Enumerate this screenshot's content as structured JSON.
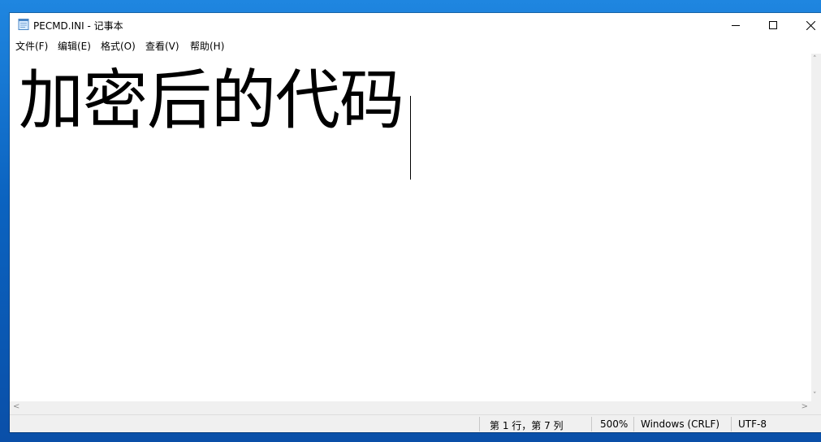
{
  "window": {
    "title": "PECMD.INI - 记事本",
    "icon": "notepad-icon",
    "controls": {
      "minimize_icon": "minimize-icon",
      "maximize_icon": "maximize-icon",
      "close_icon": "close-icon"
    }
  },
  "menu": {
    "items": [
      {
        "label": "文件(F)"
      },
      {
        "label": "编辑(E)"
      },
      {
        "label": "格式(O)"
      },
      {
        "label": "查看(V)"
      },
      {
        "label": "帮助(H)"
      }
    ]
  },
  "editor": {
    "content": "加密后的代码"
  },
  "scrollbars": {
    "up_arrow": "˄",
    "down_arrow": "˅",
    "left_arrow": "<",
    "right_arrow": ">"
  },
  "status": {
    "position": "第 1 行，第 7 列",
    "zoom": "500%",
    "line_ending": "Windows (CRLF)",
    "encoding": "UTF-8"
  },
  "colors": {
    "desktop": "#0a6fc9",
    "window_bg": "#ffffff",
    "statusbar_bg": "#f0f0f0"
  }
}
